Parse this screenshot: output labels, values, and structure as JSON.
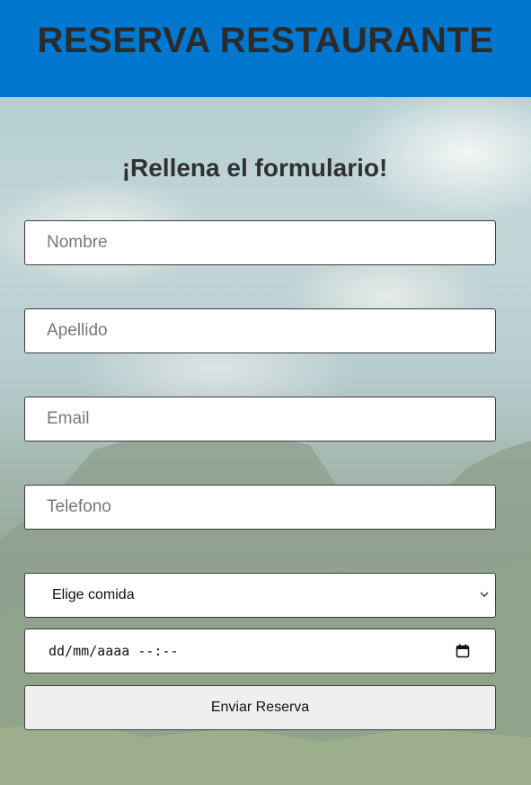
{
  "header": {
    "title": "RESERVA RESTAURANTE"
  },
  "form": {
    "heading": "¡Rellena el formulario!",
    "nombre_placeholder": "Nombre",
    "apellido_placeholder": "Apellido",
    "email_placeholder": "Email",
    "telefono_placeholder": "Telefono",
    "comida_selected": "Elige comida",
    "date_value": "dd/mm/aaaa --:--",
    "submit_label": "Enviar Reserva"
  },
  "colors": {
    "header_bg": "#0277cf",
    "title_text": "#2b2b2b",
    "button_bg": "#efefef"
  },
  "icons": {
    "select": "chevron-down-icon",
    "date": "calendar-icon"
  }
}
